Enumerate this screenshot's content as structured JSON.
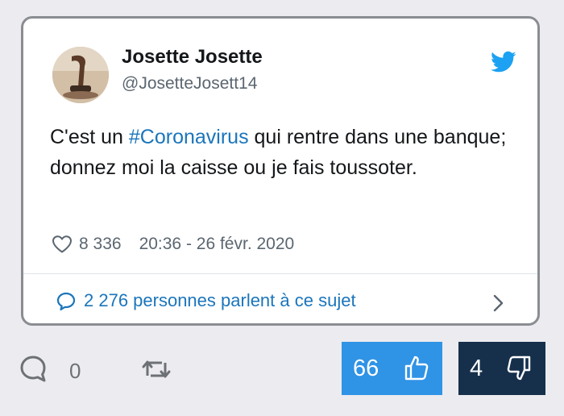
{
  "tweet": {
    "author_name": "Josette Josette",
    "author_handle": "@JosetteJosett14",
    "text_before": "C'est un ",
    "hashtag": "#Coronavirus",
    "text_after": " qui rentre dans une banque; donnez moi la caisse ou je fais toussoter.",
    "like_count": "8 336",
    "timestamp": "20:36 - 26 févr. 2020",
    "conversation_label": "2 276 personnes parlent à ce sujet",
    "icons": {
      "logo": "twitter-bird-icon",
      "like": "heart-icon",
      "conversation": "chat-bubble-icon",
      "more": "chevron-right-icon"
    },
    "colors": {
      "link": "#1b75bb",
      "brand": "#1da1f2",
      "secondary_text": "#5b6670"
    }
  },
  "actions": {
    "comment_count": "0",
    "upvotes": "66",
    "downvotes": "4",
    "icons": {
      "comment": "comment-bubble-icon",
      "share": "retweet-icon",
      "upvote": "thumbs-up-icon",
      "downvote": "thumbs-down-icon"
    },
    "colors": {
      "upvote_bg": "#2f93e6",
      "downvote_bg": "#16304c"
    }
  }
}
